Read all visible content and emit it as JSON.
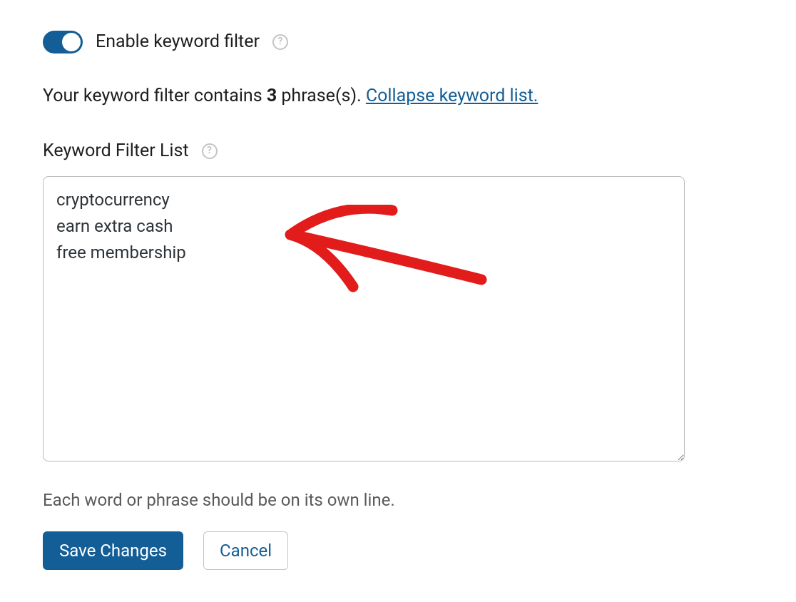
{
  "colors": {
    "accent": "#135e96"
  },
  "toggle": {
    "enabled": true,
    "label": "Enable keyword filter"
  },
  "status": {
    "prefix": "Your keyword filter contains ",
    "count": "3",
    "suffix": " phrase(s). ",
    "collapse_link": "Collapse keyword list."
  },
  "filter": {
    "label": "Keyword Filter List",
    "value": "cryptocurrency\nearn extra cash\nfree membership",
    "keywords": [
      "cryptocurrency",
      "earn extra cash",
      "free membership"
    ]
  },
  "hint": "Each word or phrase should be on its own line.",
  "buttons": {
    "save": "Save Changes",
    "cancel": "Cancel"
  },
  "annotation": {
    "type": "hand-drawn-arrow",
    "color": "#e21b1b",
    "direction": "pointing-left"
  }
}
